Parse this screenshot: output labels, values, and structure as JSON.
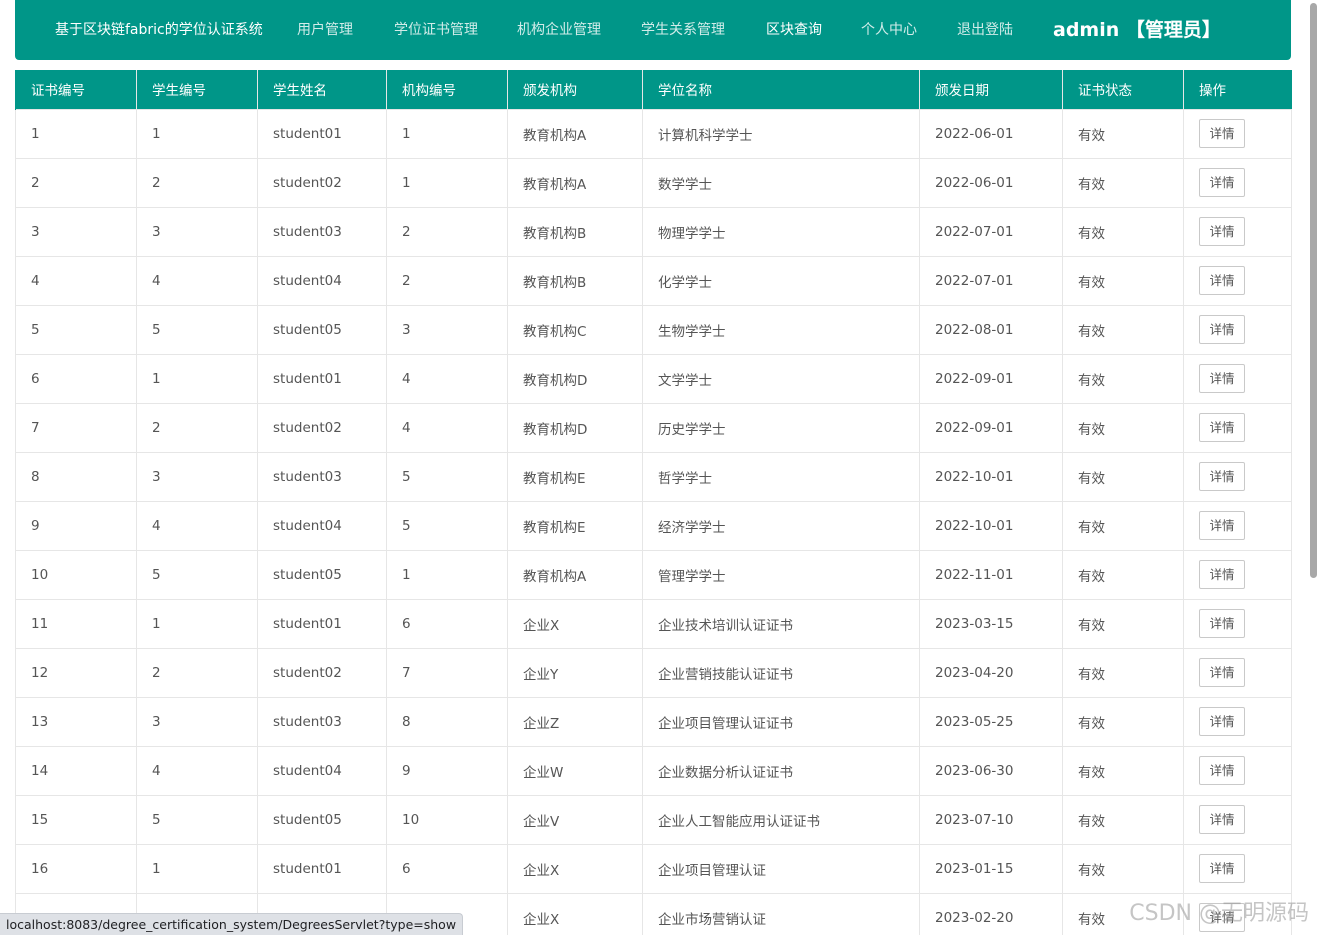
{
  "nav": {
    "brand": "基于区块链fabric的学位认证系统",
    "items": [
      "用户管理",
      "学位证书管理",
      "机构企业管理",
      "学生关系管理",
      "区块查询",
      "个人中心",
      "退出登陆"
    ],
    "user": "admin 【管理员】"
  },
  "table": {
    "columns": [
      "证书编号",
      "学生编号",
      "学生姓名",
      "机构编号",
      "颁发机构",
      "学位名称",
      "颁发日期",
      "证书状态",
      "操作"
    ],
    "action_label": "详情",
    "rows": [
      [
        "1",
        "1",
        "student01",
        "1",
        "教育机构A",
        "计算机科学学士",
        "2022-06-01",
        "有效"
      ],
      [
        "2",
        "2",
        "student02",
        "1",
        "教育机构A",
        "数学学士",
        "2022-06-01",
        "有效"
      ],
      [
        "3",
        "3",
        "student03",
        "2",
        "教育机构B",
        "物理学学士",
        "2022-07-01",
        "有效"
      ],
      [
        "4",
        "4",
        "student04",
        "2",
        "教育机构B",
        "化学学士",
        "2022-07-01",
        "有效"
      ],
      [
        "5",
        "5",
        "student05",
        "3",
        "教育机构C",
        "生物学学士",
        "2022-08-01",
        "有效"
      ],
      [
        "6",
        "1",
        "student01",
        "4",
        "教育机构D",
        "文学学士",
        "2022-09-01",
        "有效"
      ],
      [
        "7",
        "2",
        "student02",
        "4",
        "教育机构D",
        "历史学学士",
        "2022-09-01",
        "有效"
      ],
      [
        "8",
        "3",
        "student03",
        "5",
        "教育机构E",
        "哲学学士",
        "2022-10-01",
        "有效"
      ],
      [
        "9",
        "4",
        "student04",
        "5",
        "教育机构E",
        "经济学学士",
        "2022-10-01",
        "有效"
      ],
      [
        "10",
        "5",
        "student05",
        "1",
        "教育机构A",
        "管理学学士",
        "2022-11-01",
        "有效"
      ],
      [
        "11",
        "1",
        "student01",
        "6",
        "企业X",
        "企业技术培训认证证书",
        "2023-03-15",
        "有效"
      ],
      [
        "12",
        "2",
        "student02",
        "7",
        "企业Y",
        "企业营销技能认证证书",
        "2023-04-20",
        "有效"
      ],
      [
        "13",
        "3",
        "student03",
        "8",
        "企业Z",
        "企业项目管理认证证书",
        "2023-05-25",
        "有效"
      ],
      [
        "14",
        "4",
        "student04",
        "9",
        "企业W",
        "企业数据分析认证证书",
        "2023-06-30",
        "有效"
      ],
      [
        "15",
        "5",
        "student05",
        "10",
        "企业V",
        "企业人工智能应用认证证书",
        "2023-07-10",
        "有效"
      ],
      [
        "16",
        "1",
        "student01",
        "6",
        "企业X",
        "企业项目管理认证",
        "2023-01-15",
        "有效"
      ],
      [
        "",
        "",
        "",
        "",
        "企业X",
        "企业市场营销认证",
        "2023-02-20",
        "有效"
      ]
    ]
  },
  "status_bar": {
    "url": "localhost:8083/degree_certification_system/DegreesServlet?type=show"
  },
  "watermark": "CSDN @无明源码",
  "colors": {
    "primary": "#009688",
    "border": "#e6e6e6",
    "text": "#555555"
  }
}
